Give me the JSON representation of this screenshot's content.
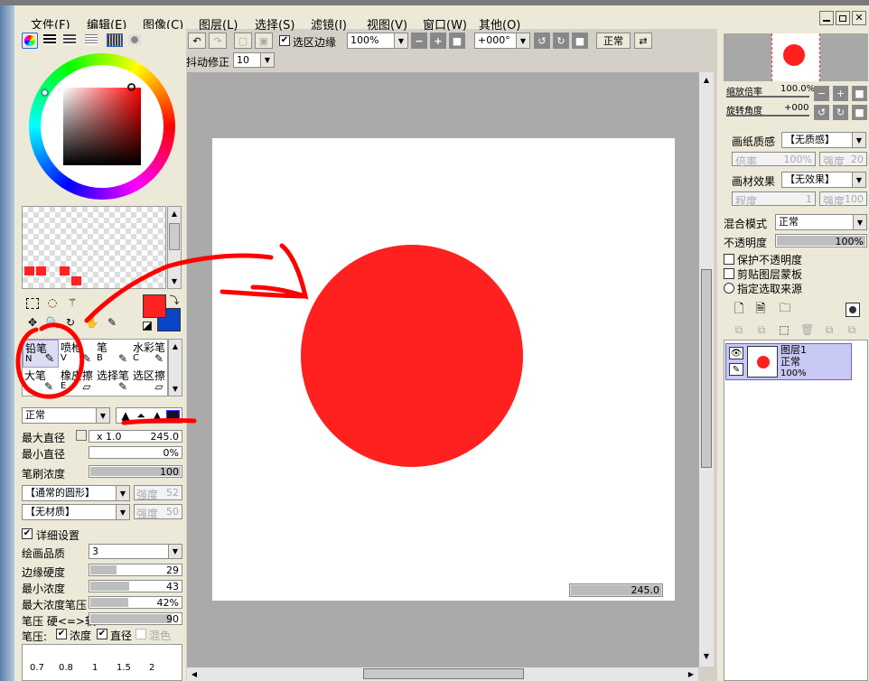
{
  "menu": [
    "文件(F)",
    "编辑(E)",
    "图像(C)",
    "图层(L)",
    "选择(S)",
    "滤镜(I)",
    "视图(V)",
    "窗口(W)",
    "其他(O)"
  ],
  "toolbar": {
    "select_edge": "选区边缘",
    "zoom": "100%",
    "rotation": "+000°",
    "blend_view": "正常",
    "stabilizer_label": "抖动修正",
    "stabilizer": "10"
  },
  "tools": {
    "row1": [
      {
        "name": "铅笔",
        "key": "N"
      },
      {
        "name": "喷枪",
        "key": "V"
      },
      {
        "name": "笔",
        "key": "B"
      },
      {
        "name": "水彩笔",
        "key": "C"
      }
    ],
    "row2": [
      {
        "name": "",
        "key": ""
      },
      {
        "name": "橡皮擦",
        "key": "E"
      },
      {
        "name": "选择笔",
        "key": ""
      },
      {
        "name": "选区擦",
        "key": ""
      }
    ],
    "sub_row": [
      "大笔",
      "橡皮擦",
      "选择笔",
      "选区擦"
    ]
  },
  "brush": {
    "mode": "正常",
    "max_size_label": "最大直径",
    "max_size_mult": "x 1.0",
    "max_size": "245.0",
    "min_size_label": "最小直径",
    "min_size": "0%",
    "density_label": "笔刷浓度",
    "density": "100",
    "shape": "【通常的圆形】",
    "shape_strength_label": "强度",
    "shape_strength": "52",
    "texture": "【无材质】",
    "texture_strength_label": "强度",
    "texture_strength": "50",
    "detail_label": "详细设置",
    "quality_label": "绘画品质",
    "quality": "3",
    "edge_label": "边缘硬度",
    "edge": "29",
    "min_density_label": "最小浓度",
    "min_density": "43",
    "max_pressure_label": "最大浓度笔压",
    "max_pressure": "42%",
    "pressure_label": "笔压  硬<=>软",
    "pressure": "90",
    "pressure2_label": "笔压:",
    "p_density": "浓度",
    "p_size": "直径",
    "p_blend": "混色"
  },
  "size_presets": [
    "0.7",
    "0.8",
    "1",
    "1.5",
    "2"
  ],
  "canvas": {
    "size_readout": "245.0"
  },
  "navigator": {
    "zoom_label": "缩放倍率",
    "zoom": "100.0%",
    "rotate_label": "旋转角度",
    "rotate": "+000"
  },
  "layer_panel": {
    "paper_label": "画纸质感",
    "paper": "【无质感】",
    "rate_label": "倍率",
    "rate": "100%",
    "strength_label": "强度",
    "strength": "20",
    "effect_label": "画材效果",
    "effect": "【无效果】",
    "degree_label": "程度",
    "degree": "1",
    "strength2_label": "强度",
    "strength2": "100",
    "blend_label": "混合模式",
    "blend": "正常",
    "opacity_label": "不透明度",
    "opacity": "100%",
    "protect": "保护不透明度",
    "clip": "剪贴图层蒙板",
    "source": "指定选取来源"
  },
  "layer": {
    "name": "图层1",
    "mode": "正常",
    "opacity": "100%"
  },
  "colors": {
    "primary": "#ff2222",
    "secondary": "#0c44c8",
    "circle": "#ff2020",
    "annotation": "#ff0000"
  }
}
